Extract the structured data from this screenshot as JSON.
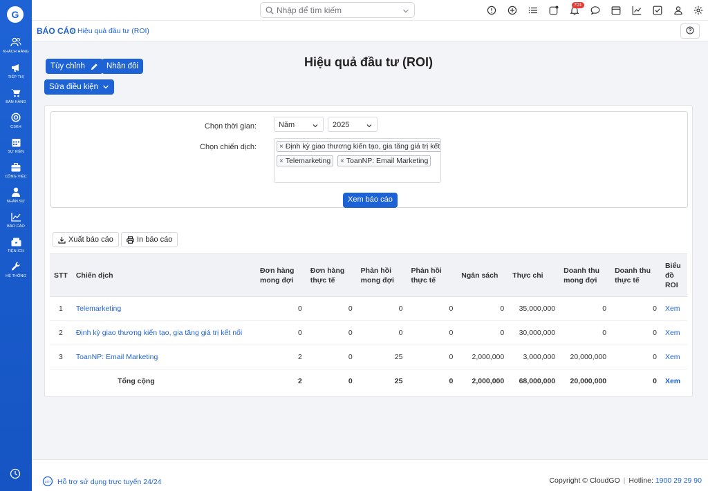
{
  "sidebar": {
    "logo_icon": "cloudgo-logo-icon",
    "items": [
      {
        "label": "KHÁCH HÀNG",
        "icon": "users-icon"
      },
      {
        "label": "TIẾP THỊ",
        "icon": "megaphone-icon"
      },
      {
        "label": "BÁN HÀNG",
        "icon": "cart-icon"
      },
      {
        "label": "CSKH",
        "icon": "lifebuoy-icon"
      },
      {
        "label": "SỰ KIỆN",
        "icon": "calendar-icon"
      },
      {
        "label": "CÔNG VIỆC",
        "icon": "briefcase-icon"
      },
      {
        "label": "NHÂN SỰ",
        "icon": "person-icon"
      },
      {
        "label": "BÁO CÁO",
        "icon": "chart-icon"
      },
      {
        "label": "TIỆN ÍCH",
        "icon": "utilities-icon"
      },
      {
        "label": "HỆ THỐNG",
        "icon": "wrench-icon"
      }
    ],
    "bottom_icon": "clock-icon"
  },
  "topbar": {
    "search_placeholder": "Nhập để tìm kiếm",
    "notification_count": "701"
  },
  "breadcrumb": {
    "root": "BÁO CÁO",
    "current": "Hiệu quả đầu tư (ROI)"
  },
  "toolbar": {
    "customize_label": "Tùy chỉnh",
    "duplicate_label": "Nhân đôi",
    "edit_conditions_label": "Sửa điều kiện"
  },
  "page": {
    "title": "Hiệu quả đầu tư (ROI)"
  },
  "filters": {
    "time_label": "Chọn thời gian:",
    "period_value": "Năm",
    "year_value": "2025",
    "campaign_label": "Chọn chiến dịch:",
    "campaigns": [
      "Định kỳ giao thương kiến tạo, gia tăng giá trị kết",
      "Telemarketing",
      "ToanNP: Email Marketing"
    ],
    "view_report_label": "Xem báo cáo"
  },
  "actions": {
    "export_label": "Xuất báo cáo",
    "print_label": "In báo cáo"
  },
  "table": {
    "headers": [
      "STT",
      "Chiến dịch",
      "Đơn hàng mong đợi",
      "Đơn hàng thực tế",
      "Phản hồi mong đợi",
      "Phản hồi thực tế",
      "Ngân sách",
      "Thực chi",
      "Doanh thu mong đợi",
      "Doanh thu thực tế",
      "Biểu đồ ROI"
    ],
    "rows": [
      [
        "1",
        "Telemarketing",
        "0",
        "0",
        "0",
        "0",
        "0",
        "35,000,000",
        "0",
        "0",
        "Xem"
      ],
      [
        "2",
        "Định kỳ giao thương kiến tạo, gia tăng giá trị kết nối",
        "0",
        "0",
        "0",
        "0",
        "0",
        "30,000,000",
        "0",
        "0",
        "Xem"
      ],
      [
        "3",
        "ToanNP: Email Marketing",
        "2",
        "0",
        "25",
        "0",
        "2,000,000",
        "3,000,000",
        "20,000,000",
        "0",
        "Xem"
      ]
    ],
    "total": [
      "Tổng cộng",
      "2",
      "0",
      "25",
      "0",
      "2,000,000",
      "68,000,000",
      "20,000,000",
      "0",
      "Xem"
    ]
  },
  "footer": {
    "support_text": "Hỗ trợ sử dụng trực tuyến 24/24",
    "copyright": "Copyright © CloudGO",
    "hotline_label": "Hotline:",
    "hotline_number": "1900 29 29 90"
  },
  "colors": {
    "primary": "#1e63d6",
    "badge": "#e53935"
  }
}
